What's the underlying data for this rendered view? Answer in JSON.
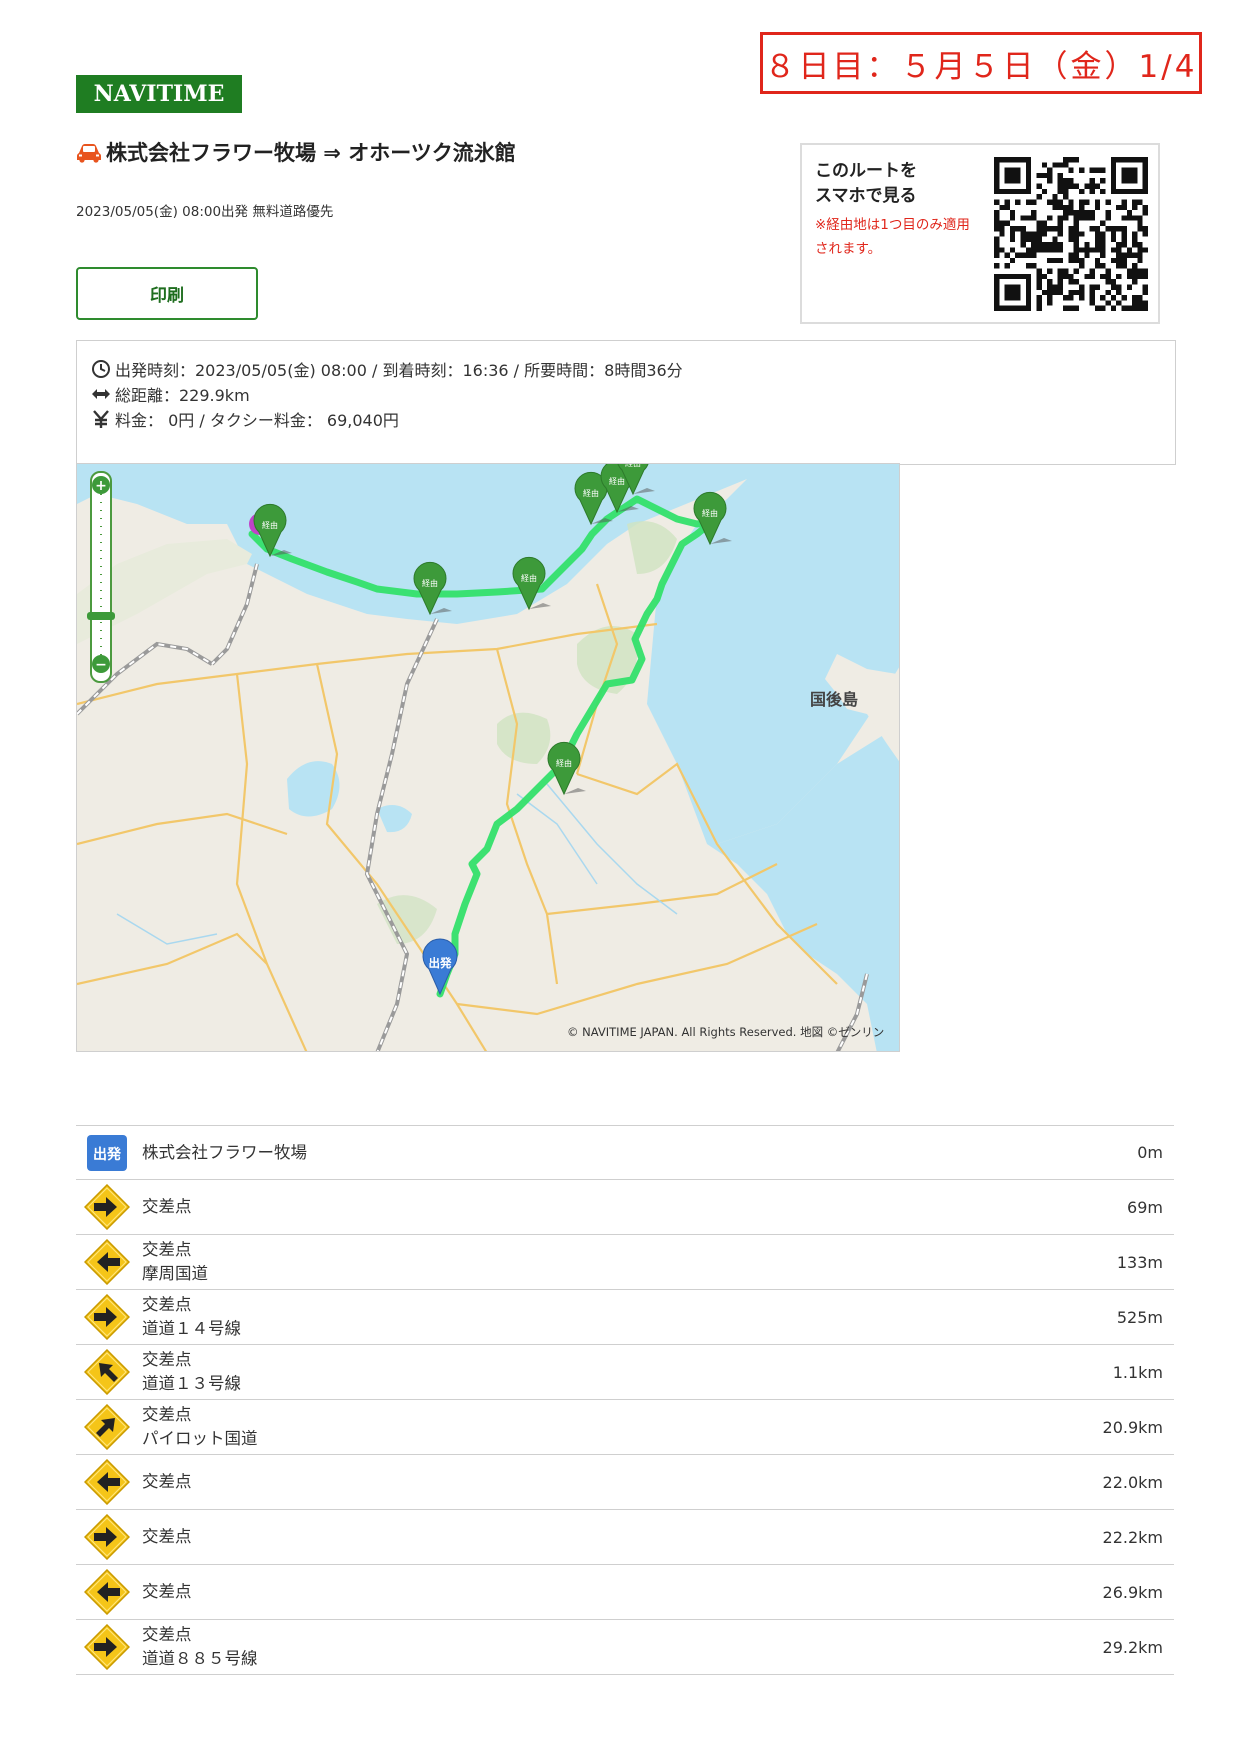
{
  "header": {
    "day_label": "８日目：５月５日（金）1/4",
    "logo": "NAVITIME"
  },
  "route": {
    "title": "株式会社フラワー牧場 ⇒ オホーツク流氷館",
    "subtitle": "2023/05/05(金) 08:00出発 無料道路優先",
    "print_label": "印刷"
  },
  "qr": {
    "heading_line1": "このルートを",
    "heading_line2": "スマホで見る",
    "note": "※経由地は1つ目のみ適用されます。"
  },
  "summary": {
    "times": "出発時刻：2023/05/05(金) 08:00 / 到着時刻：16:36 / 所要時間：8時間36分",
    "distance": "総距離：229.9km",
    "fare": "料金： 0円 / タクシー料金： 69,040円"
  },
  "map": {
    "start_label": "出発",
    "via_label": "経由",
    "island_label": "国後島",
    "copyright": "© NAVITIME JAPAN. All Rights Reserved. 地図 ©ゼンリン",
    "zoom_in": "+",
    "zoom_out": "−",
    "colors": {
      "sea": "#b8e3f3",
      "route": "#33e06a",
      "pin": "#3d9a3a",
      "start_pin": "#3a7bd5"
    }
  },
  "steps": [
    {
      "type": "start",
      "badge": "出発",
      "line1": "株式会社フラワー牧場",
      "line2": "",
      "distance": "0m"
    },
    {
      "type": "right",
      "line1": "交差点",
      "line2": "",
      "distance": "69m"
    },
    {
      "type": "left",
      "line1": "交差点",
      "line2": "摩周国道",
      "distance": "133m"
    },
    {
      "type": "right",
      "line1": "交差点",
      "line2": "道道１４号線",
      "distance": "525m"
    },
    {
      "type": "upleft",
      "line1": "交差点",
      "line2": "道道１３号線",
      "distance": "1.1km"
    },
    {
      "type": "upright",
      "line1": "交差点",
      "line2": "パイロット国道",
      "distance": "20.9km"
    },
    {
      "type": "left",
      "line1": "交差点",
      "line2": "",
      "distance": "22.0km"
    },
    {
      "type": "right",
      "line1": "交差点",
      "line2": "",
      "distance": "22.2km"
    },
    {
      "type": "left",
      "line1": "交差点",
      "line2": "",
      "distance": "26.9km"
    },
    {
      "type": "right",
      "line1": "交差点",
      "line2": "道道８８５号線",
      "distance": "29.2km"
    }
  ]
}
